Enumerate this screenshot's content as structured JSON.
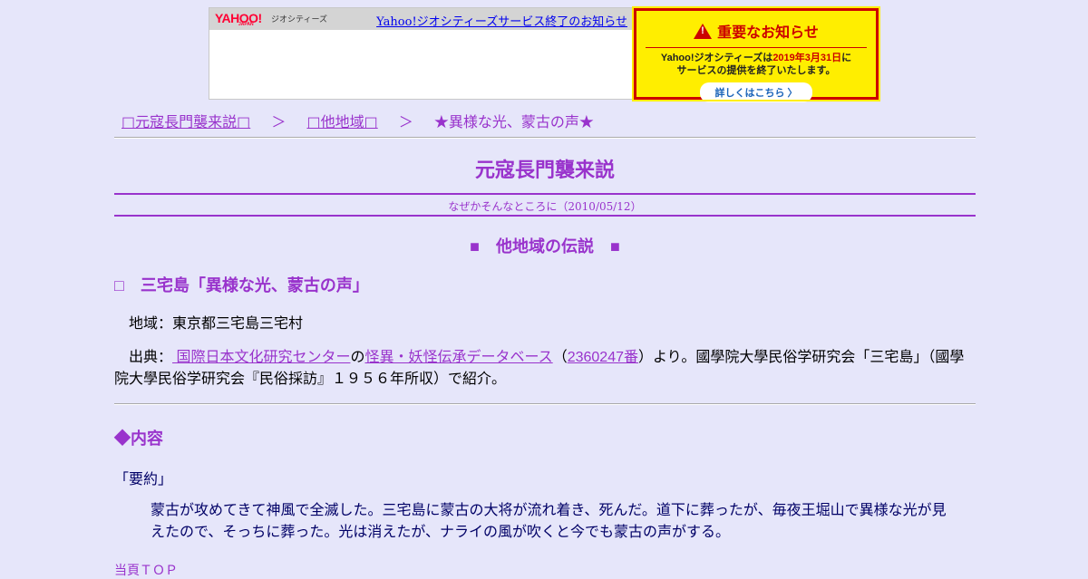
{
  "banner": {
    "logo": "YAHOO!",
    "logo_sub": "JAPAN",
    "geo_label": "ジオシティーズ",
    "service_link": "Yahoo!ジオシティーズサービス終了のお知らせ",
    "notice_title": "重要なお知らせ",
    "notice_line1_a": "Yahoo!ジオシティーズは",
    "notice_line1_date": "2019年3月31日",
    "notice_line1_b": "に",
    "notice_line2": "サービスの提供を終了いたします。",
    "notice_button": "詳しくはこちら 〉",
    "colors": {
      "notice_bg": "#ffee00",
      "notice_border": "#cc0000"
    }
  },
  "breadcrumb": {
    "home": "□元寇長門襲来説□",
    "sep": "＞",
    "section": "□他地域□",
    "current": "★異様な光、蒙古の声★"
  },
  "site_title": "元寇長門襲来説",
  "subtitle": "なぜかそんなところに（2010/05/12）",
  "section_title": "■　他地域の伝説　■",
  "heading": "□　三宅島「異様な光、蒙古の声」",
  "region": "地域：東京都三宅島三宅村",
  "source": {
    "prefix": "出典：",
    "link1": " 国際日本文化研究センター",
    "mid1": "の",
    "link2": "怪異・妖怪伝承データベース",
    "mid2": "（",
    "link3": "2360247番",
    "suffix": "）より。國學院大學民俗学研究会「三宅島」（國學院大學民俗学研究会『民俗採訪』１９５６年所収）で紹介。"
  },
  "content_heading": "◆内容",
  "summary_label": "「要約」",
  "summary_text": "蒙古が攻めてきて神風で全滅した。三宅島に蒙古の大将が流れ着き、死んだ。道下に葬ったが、毎夜王堀山で異様な光が見えたので、そっちに葬った。光は消えたが、ナライの風が吹くと今でも蒙古の声がする。",
  "top_link": "当頁ＴＯＰ",
  "colors": {
    "page_bg": "#e6e6fa",
    "accent": "#9933cc",
    "text_navy": "#000066"
  }
}
